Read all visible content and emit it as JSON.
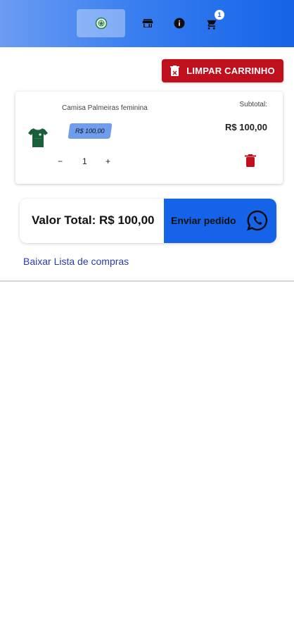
{
  "navbar": {
    "icons": [
      "palmeiras-logo-icon",
      "store-icon",
      "info-icon",
      "cart-icon"
    ],
    "cart_badge": "1",
    "colors": {
      "gradient_start": "#6b9cf2",
      "gradient_end": "#1463e8"
    }
  },
  "actions": {
    "clear_cart_label": "LIMPAR CARRINHO",
    "clear_cart_color": "#c0101d"
  },
  "cart": {
    "items": [
      {
        "name": "Camisa Palmeiras feminina",
        "price": "R$ 100,00",
        "quantity": "1",
        "decrement": "−",
        "increment": "+",
        "subtotal_label": "Subtotal:",
        "subtotal_value": "R$ 100,00"
      }
    ]
  },
  "summary": {
    "total_text": "Valor Total: R$ 100,00",
    "send_label": "Enviar pedido",
    "send_color": "#1463e8"
  },
  "links": {
    "download_list": "Baixar Lista de compras"
  }
}
